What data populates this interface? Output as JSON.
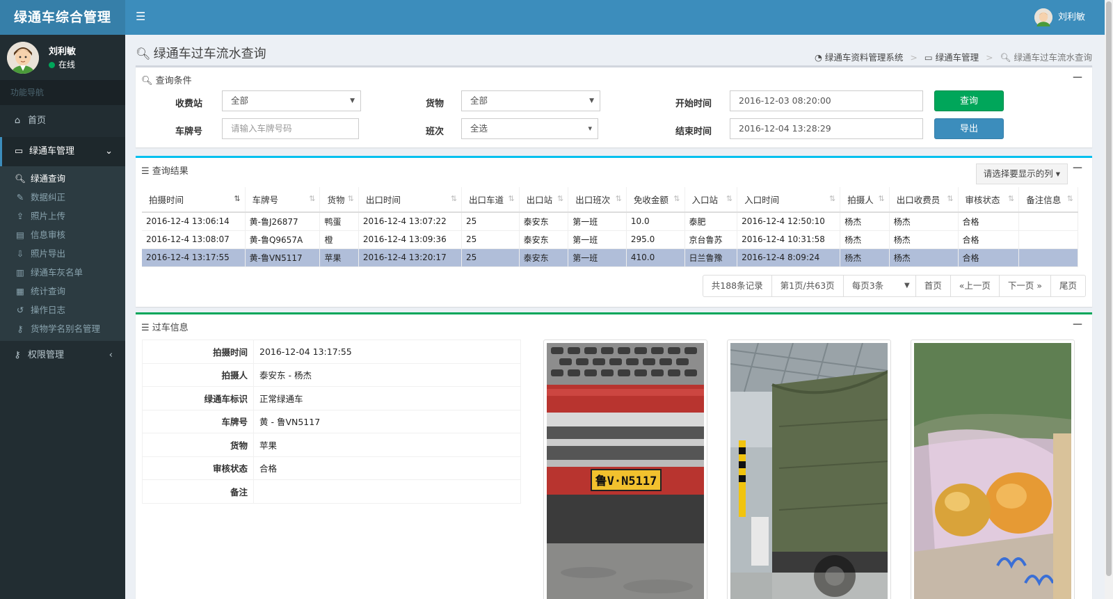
{
  "app": {
    "title": "绿通车综合管理",
    "user_name": "刘利敏",
    "user_status": "在线",
    "nav_header": "功能导航"
  },
  "menu": {
    "home": "首页",
    "green_mgmt": "绿通车管理",
    "sub_items": [
      "绿通查询",
      "数据纠正",
      "照片上传",
      "信息审核",
      "照片导出",
      "绿通车灰名单",
      "统计查询",
      "操作日志",
      "货物学名别名管理"
    ],
    "auth_mgmt": "权限管理"
  },
  "header": {
    "page_title": "绿通车过车流水查询",
    "breadcrumb": [
      "绿通车资料管理系统",
      "绿通车管理",
      "绿通车过车流水查询"
    ]
  },
  "search": {
    "title": "查询条件",
    "station_label": "收费站",
    "station_value": "全部",
    "goods_label": "货物",
    "goods_value": "全部",
    "start_label": "开始时间",
    "start_value": "2016-12-03 08:20:00",
    "plate_label": "车牌号",
    "plate_placeholder": "请输入车牌号码",
    "shift_label": "班次",
    "shift_value": "全选",
    "end_label": "结束时间",
    "end_value": "2016-12-04 13:28:29",
    "query_btn": "查询",
    "export_btn": "导出"
  },
  "results": {
    "title": "查询结果",
    "column_chooser": "请选择要显示的列",
    "columns": [
      "拍摄时间",
      "车牌号",
      "货物",
      "出口时间",
      "出口车道",
      "出口站",
      "出口班次",
      "免收金额",
      "入口站",
      "入口时间",
      "拍摄人",
      "出口收费员",
      "审核状态",
      "备注信息"
    ],
    "rows": [
      [
        "2016-12-4 13:06:14",
        "黄-鲁J26877",
        "鸭蛋",
        "2016-12-4 13:07:22",
        "25",
        "泰安东",
        "第一班",
        "10.0",
        "泰肥",
        "2016-12-4 12:50:10",
        "杨杰",
        "杨杰",
        "合格",
        ""
      ],
      [
        "2016-12-4 13:08:07",
        "黄-鲁Q9657A",
        "橙",
        "2016-12-4 13:09:36",
        "25",
        "泰安东",
        "第一班",
        "295.0",
        "京台鲁苏",
        "2016-12-4 10:31:58",
        "杨杰",
        "杨杰",
        "合格",
        ""
      ],
      [
        "2016-12-4 13:17:55",
        "黄-鲁VN5117",
        "苹果",
        "2016-12-4 13:20:17",
        "25",
        "泰安东",
        "第一班",
        "410.0",
        "日兰鲁豫",
        "2016-12-4 8:09:24",
        "杨杰",
        "杨杰",
        "合格",
        ""
      ]
    ],
    "pager": {
      "total": "共188条记录",
      "page": "第1页/共63页",
      "per_page": "每页3条",
      "first": "首页",
      "prev": "«上一页",
      "next": "下一页 »",
      "last": "尾页"
    }
  },
  "detail": {
    "title": "过车信息",
    "fields": [
      {
        "k": "拍摄时间",
        "v": "2016-12-04 13:17:55"
      },
      {
        "k": "拍摄人",
        "v": "泰安东 - 杨杰"
      },
      {
        "k": "绿通车标识",
        "v": "正常绿通车"
      },
      {
        "k": "车牌号",
        "v": "黄 - 鲁VN5117"
      },
      {
        "k": "货物",
        "v": "苹果"
      },
      {
        "k": "审核状态",
        "v": "合格"
      },
      {
        "k": "备注",
        "v": ""
      }
    ],
    "plate_text": "鲁V·N5117"
  }
}
